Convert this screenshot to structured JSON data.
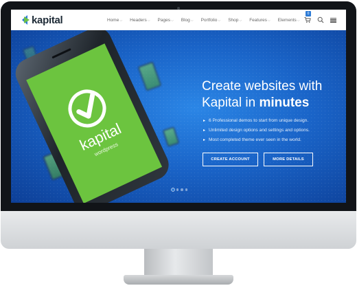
{
  "brand": {
    "name": "kapital",
    "logo_colors": [
      "#2d7bd6",
      "#6cc04a"
    ]
  },
  "nav": {
    "items": [
      {
        "label": "Home"
      },
      {
        "label": "Headers"
      },
      {
        "label": "Pages"
      },
      {
        "label": "Blog"
      },
      {
        "label": "Portfolio"
      },
      {
        "label": "Shop"
      },
      {
        "label": "Features"
      },
      {
        "label": "Elements"
      }
    ],
    "cart_count": "0",
    "icons": [
      "cart-icon",
      "search-icon",
      "hamburger-menu-icon"
    ]
  },
  "hero": {
    "title_line1": "Create websites with",
    "title_line2_prefix": "Kapital in ",
    "title_line2_bold": "minutes",
    "features": [
      "6 Professional demos to start from unique design.",
      "Unlimited design options and settings and options.",
      "Most completed theme ever seen in the world."
    ],
    "buttons": {
      "create_account": "CREATE ACCOUNT",
      "more_details": "MORE DETAILS"
    },
    "phone_logo": "kapital",
    "phone_sublabel": "wordpress",
    "slider": {
      "total": 4,
      "active": 1
    },
    "colors": {
      "accent": "#2d7bd6",
      "phone_green": "#6cc43f",
      "background": "#1a64c8"
    }
  }
}
